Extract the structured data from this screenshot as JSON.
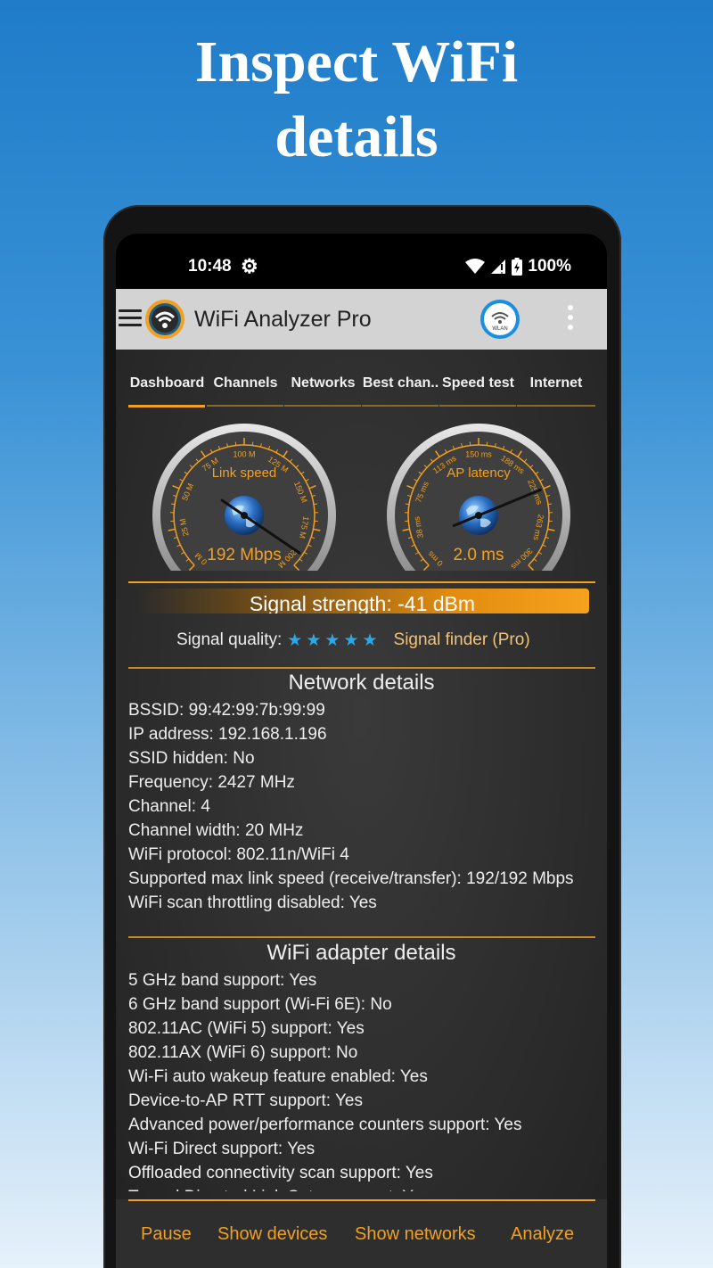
{
  "headline": {
    "line1": "Inspect WiFi",
    "line2": "details"
  },
  "status_bar": {
    "time": "10:48",
    "battery": "100%"
  },
  "app_bar": {
    "title": "WiFi Analyzer Pro",
    "wlan_label": "WLAN"
  },
  "tabs": [
    {
      "label": "Dashboard",
      "active": true
    },
    {
      "label": "Channels"
    },
    {
      "label": "Networks"
    },
    {
      "label": "Best chan.."
    },
    {
      "label": "Speed test"
    },
    {
      "label": "Internet"
    }
  ],
  "gauges": {
    "link_speed": {
      "title": "Link speed",
      "value": "192 Mbps",
      "ticks": [
        "0 M",
        "25 M",
        "50 M",
        "75 M",
        "100 M",
        "125 M",
        "150 M",
        "175 M",
        "200 M"
      ],
      "needle_fraction": 0.96
    },
    "ap_latency": {
      "title": "AP latency",
      "value": "2.0 ms",
      "ticks": [
        "0 ms",
        "38 ms",
        "75 ms",
        "113 ms",
        "150 ms",
        "188 ms",
        "225 ms",
        "263 ms",
        "300 ms"
      ],
      "needle_fraction": 0.75
    }
  },
  "signal": {
    "strength_text": "Signal strength: -41 dBm",
    "quality_label": "Signal quality:",
    "stars": 5,
    "finder_link": "Signal finder (Pro)",
    "colors": {
      "accent": "#f2a021",
      "star": "#2fa7e6"
    }
  },
  "network_details": {
    "title": "Network details",
    "lines": [
      "BSSID: 99:42:99:7b:99:99",
      "IP address: 192.168.1.196",
      "SSID hidden: No",
      "Frequency: 2427 MHz",
      "Channel: 4",
      "Channel width: 20 MHz",
      "WiFi protocol: 802.11n/WiFi 4",
      "Supported max link speed (receive/transfer): 192/192 Mbps",
      "WiFi scan throttling disabled: Yes"
    ]
  },
  "adapter_details": {
    "title": "WiFi adapter details",
    "lines": [
      "5 GHz band support: Yes",
      "6 GHz band support (Wi-Fi 6E): No",
      "802.11AC (WiFi 5) support: Yes",
      "802.11AX (WiFi 6) support: No",
      "Wi-Fi auto wakeup feature enabled: Yes",
      "Device-to-AP RTT support: Yes",
      "Advanced power/performance counters support: Yes",
      "Wi-Fi Direct support: Yes",
      "Offloaded connectivity scan support: Yes",
      "Tunnel Directed Link Setup support: Yes"
    ]
  },
  "bottom_bar": {
    "pause": "Pause",
    "show_devices": "Show devices",
    "show_networks": "Show networks",
    "analyze": "Analyze"
  }
}
